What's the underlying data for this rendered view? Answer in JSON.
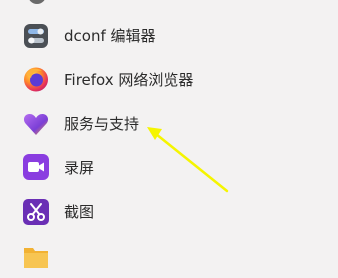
{
  "menu": {
    "items": [
      {
        "label": "dconf 编辑器",
        "icon": "dconf-editor-icon"
      },
      {
        "label": "Firefox 网络浏览器",
        "icon": "firefox-icon"
      },
      {
        "label": "服务与支持",
        "icon": "service-support-heart-icon"
      },
      {
        "label": "录屏",
        "icon": "screen-recorder-icon"
      },
      {
        "label": "截图",
        "icon": "screenshot-scissors-icon"
      },
      {
        "label": "",
        "icon": "folder-icon"
      }
    ]
  },
  "annotation": {
    "arrow_color": "#f5f500",
    "points_to": "服务与支持"
  },
  "colors": {
    "background": "#f3f2f2",
    "text": "#2b2b2b"
  }
}
